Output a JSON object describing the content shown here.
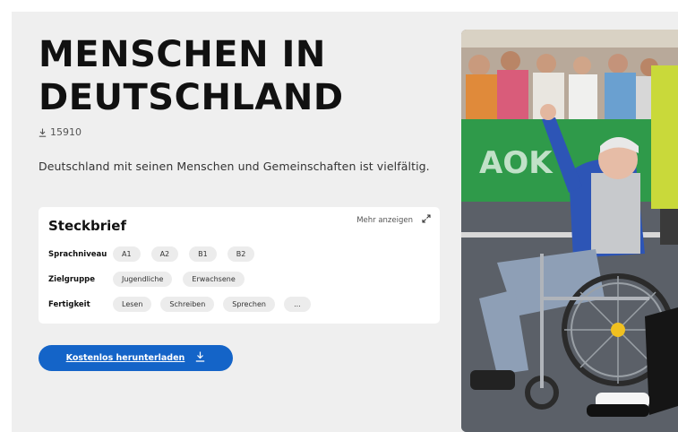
{
  "header": {
    "title_line1": "MENSCHEN IN",
    "title_line2": "DEUTSCHLAND",
    "download_count": "15910"
  },
  "intro": "Deutschland mit seinen Menschen und Gemeinschaften ist vielfältig.",
  "card": {
    "title": "Steckbrief",
    "more_label": "Mehr anzeigen",
    "rows": [
      {
        "label": "Sprachniveau",
        "chips": [
          "A1",
          "A2",
          "B1",
          "B2"
        ]
      },
      {
        "label": "Zielgruppe",
        "chips": [
          "Jugendliche",
          "Erwachsene"
        ]
      },
      {
        "label": "Fertigkeit",
        "chips": [
          "Lesen",
          "Schreiben",
          "Sprechen",
          "..."
        ]
      }
    ]
  },
  "cta": {
    "label": "Kostenlos herunterladen"
  },
  "colors": {
    "accent": "#1464c8",
    "panel": "#efefef"
  }
}
